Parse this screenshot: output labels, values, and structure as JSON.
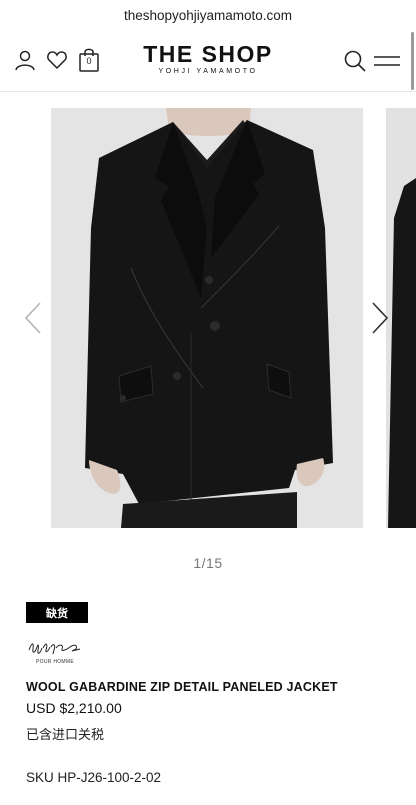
{
  "browser": {
    "url": "theshopyohjiyamamoto.com"
  },
  "header": {
    "logo_main": "THE SHOP",
    "logo_sub": "YOHJI YAMAMOTO",
    "cart_count": "0"
  },
  "icons": [
    "user-icon",
    "heart-icon",
    "shopping-bag-icon",
    "search-icon",
    "menu-icon",
    "chevron-left-icon",
    "chevron-right-icon"
  ],
  "gallery": {
    "counter": "1/15"
  },
  "product": {
    "status_badge": "缺货",
    "brand_sub": "POUR HOMME",
    "title": "WOOL GABARDINE ZIP DETAIL PANELED JACKET",
    "price": "USD $2,210.00",
    "tax_note": "已含进口关税",
    "sku": "SKU HP-J26-100-2-02"
  },
  "colors": {
    "badge_bg": "#000000",
    "photo_bg": "#e3e3e3",
    "jacket": "#141414"
  }
}
